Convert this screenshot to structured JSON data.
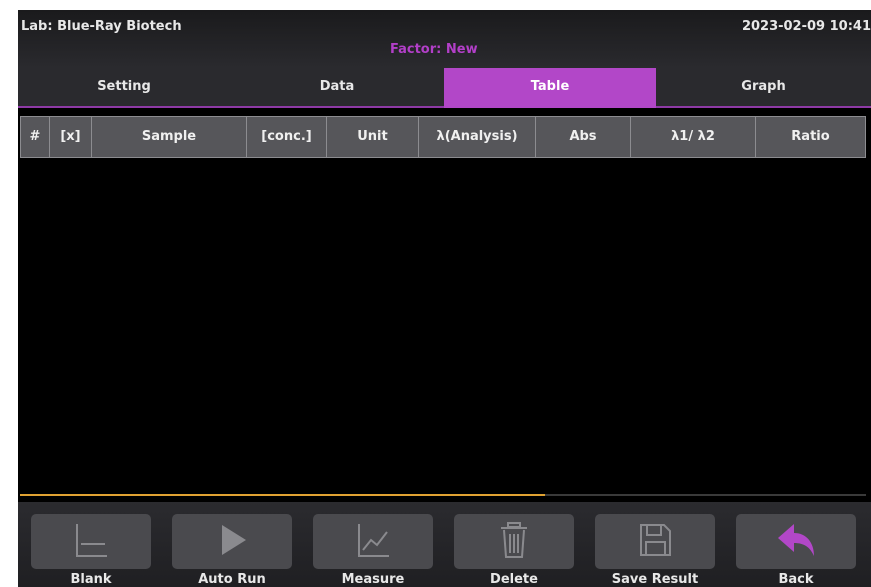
{
  "header": {
    "lab": "Lab: Blue-Ray Biotech",
    "factor": "Factor: New",
    "datetime": "2023-02-09 10:41"
  },
  "tabs": [
    {
      "label": "Setting",
      "active": false
    },
    {
      "label": "Data",
      "active": false
    },
    {
      "label": "Table",
      "active": true
    },
    {
      "label": "Graph",
      "active": false
    }
  ],
  "table": {
    "columns": [
      "#",
      "[x]",
      "Sample",
      "[conc.]",
      "Unit",
      "λ(Analysis)",
      "Abs",
      "λ1/ λ2",
      "Ratio"
    ],
    "rows": []
  },
  "progress": {
    "fraction": 0.62
  },
  "bottom": {
    "buttons": [
      {
        "label": "Blank",
        "icon": "blank-icon"
      },
      {
        "label": "Auto Run",
        "icon": "play-icon"
      },
      {
        "label": "Measure",
        "icon": "measure-chart-icon"
      },
      {
        "label": "Delete",
        "icon": "trash-icon"
      },
      {
        "label": "Save Result",
        "icon": "save-icon"
      },
      {
        "label": "Back",
        "icon": "back-arrow-icon"
      }
    ]
  },
  "colors": {
    "accent": "#b247c8",
    "progress": "#e0a232",
    "back_icon": "#b247c8"
  }
}
